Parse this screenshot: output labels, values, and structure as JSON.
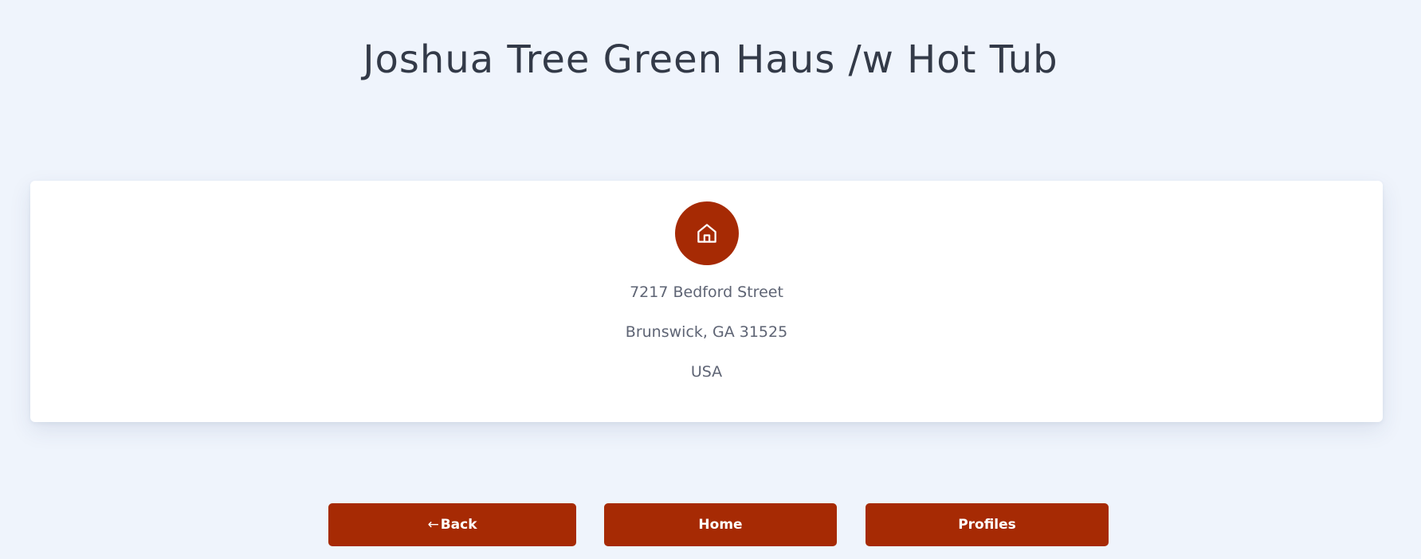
{
  "property": {
    "title": "Joshua Tree Green Haus /w Hot Tub"
  },
  "address": {
    "icon": "home-icon",
    "street": "7217 Bedford Street",
    "city_state_zip": "Brunswick, GA 31525",
    "country": "USA"
  },
  "nav": {
    "back_icon": "arrow-left-icon",
    "back_arrow": "←",
    "back_label": "Back",
    "home_label": "Home",
    "profiles_label": "Profiles"
  },
  "colors": {
    "background": "#eff4fc",
    "accent": "#a62a04",
    "card": "#ffffff",
    "title_text": "#333a48",
    "body_text": "#5e6474"
  }
}
